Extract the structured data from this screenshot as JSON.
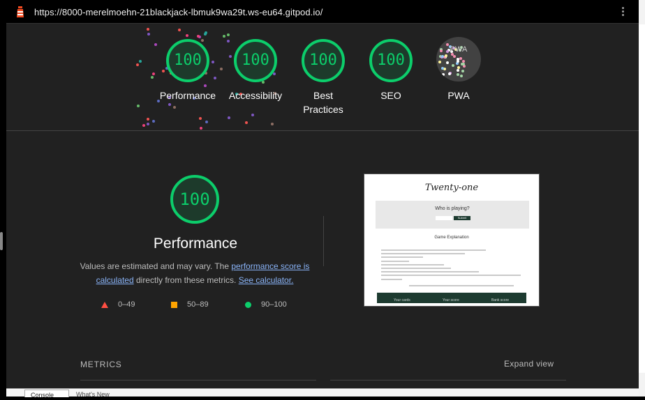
{
  "urlbar": {
    "url": "https://8000-merelmoehn-21blackjack-lbmuk9wa29t.ws-eu64.gitpod.io/",
    "menu_icon": "kebab-menu-icon",
    "logo_icon": "lighthouse-icon"
  },
  "categories": [
    {
      "score": "100",
      "label": "Performance"
    },
    {
      "score": "100",
      "label": "Accessibility"
    },
    {
      "score": "100",
      "label": "Best Practices"
    },
    {
      "score": "100",
      "label": "SEO"
    },
    {
      "score": "",
      "label": "PWA",
      "badge": "PWA"
    }
  ],
  "performance": {
    "score": "100",
    "title": "Performance",
    "desc_prefix": "Values are estimated and may vary. The ",
    "link1": "performance score is calculated",
    "desc_mid": " directly from these metrics. ",
    "link2": "See calculator.",
    "legend": [
      {
        "shape": "triangle",
        "range": "0–49",
        "color": "#ff4e42"
      },
      {
        "shape": "square",
        "range": "50–89",
        "color": "#ffa400"
      },
      {
        "shape": "circle",
        "range": "90–100",
        "color": "#0cce6b"
      }
    ]
  },
  "screenshot": {
    "title": "Twenty-one",
    "question": "Who is playing?",
    "submit": "Submit",
    "subtitle": "Game Explanation",
    "footer": [
      "Your cards",
      "Your score",
      "Bank score"
    ]
  },
  "metrics": {
    "heading": "METRICS",
    "expand": "Expand view"
  },
  "bottom_tabs": [
    "Console",
    "What's New"
  ],
  "colors": {
    "pass": "#0cce6b",
    "average": "#ffa400",
    "fail": "#ff4e42",
    "background": "#212121"
  }
}
